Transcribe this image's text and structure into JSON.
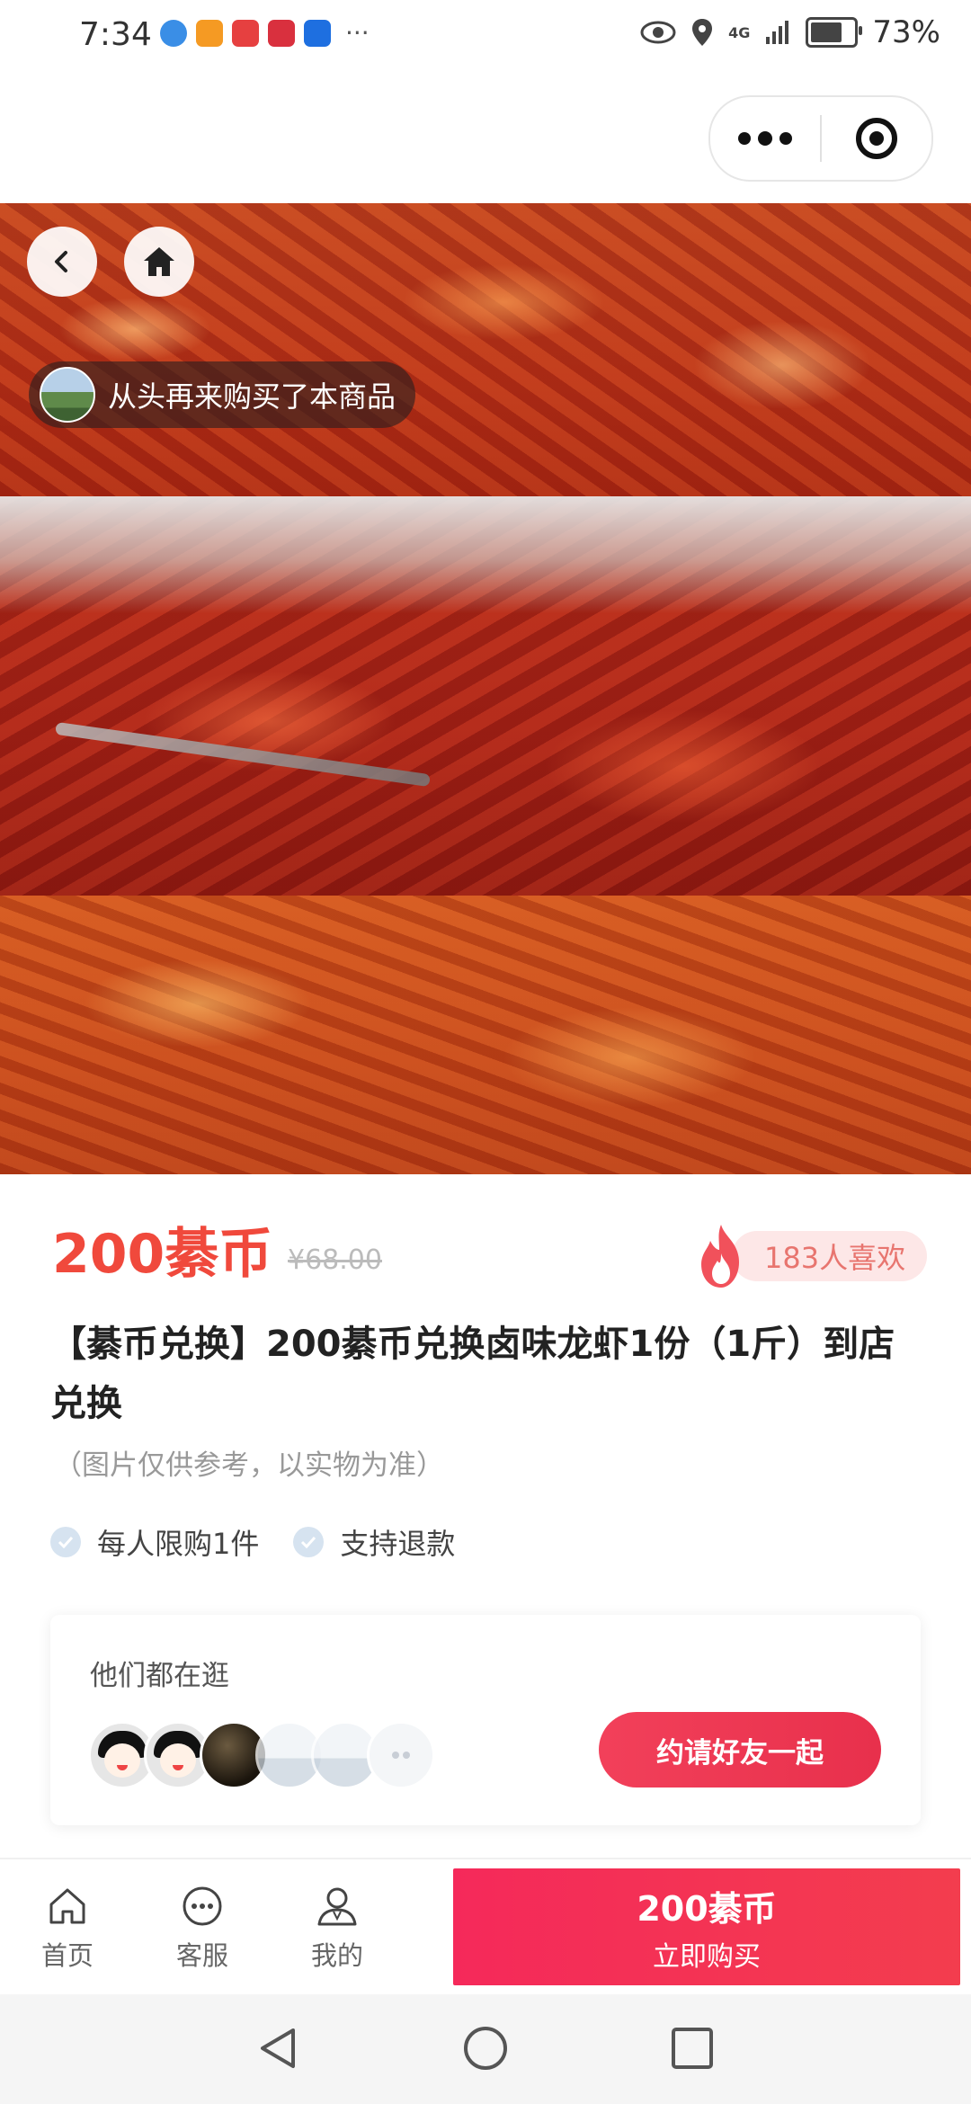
{
  "status_bar": {
    "time": "7:34",
    "network": "4G",
    "battery_percent": "73%",
    "battery_level": 0.73
  },
  "capsule": {
    "more_icon": "more-dots-icon",
    "close_icon": "target-icon"
  },
  "gallery": {
    "buyer_toast": "从头再来购买了本商品"
  },
  "product": {
    "price": "200綦币",
    "original_price": "¥68.00",
    "likes": "183人喜欢",
    "title": "【綦币兑换】200綦币兑换卤味龙虾1份（1斤）到店兑换",
    "note": "（图片仅供参考，以实物为准）",
    "perks": [
      "每人限购1件",
      "支持退款"
    ]
  },
  "browsing": {
    "title": "他们都在逛",
    "invite_label": "约请好友一起"
  },
  "bottom_bar": {
    "tabs": [
      {
        "label": "首页",
        "icon": "home-icon"
      },
      {
        "label": "客服",
        "icon": "chat-icon"
      },
      {
        "label": "我的",
        "icon": "user-icon"
      }
    ],
    "buy_price": "200綦币",
    "buy_label": "立即购买"
  },
  "colors": {
    "accent_red": "#f0493c",
    "buy_button": "#f5295a",
    "likes_pill_bg": "#fde7e7"
  }
}
